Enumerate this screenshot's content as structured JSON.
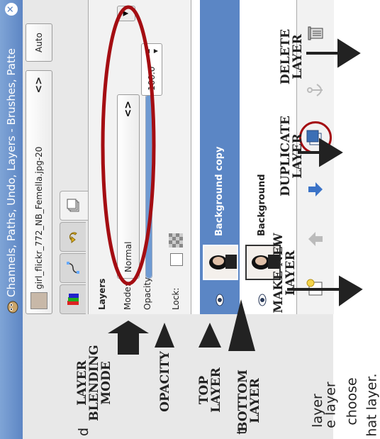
{
  "window": {
    "title": "Channels, Paths, Undo, Layers - Brushes, Patte",
    "close_icon": "close-icon",
    "app_icon": "gimp-icon"
  },
  "image_selector": {
    "filename": "girl_flickr_772_NB_Femella.jpg-20",
    "arrows": "<>",
    "auto_label": "Auto"
  },
  "tabs": [
    {
      "name": "tab-channels",
      "icon": "channels-icon"
    },
    {
      "name": "tab-paths",
      "icon": "paths-icon"
    },
    {
      "name": "tab-undo",
      "icon": "undo-icon"
    },
    {
      "name": "tab-layers",
      "icon": "layers-icon",
      "active": true
    }
  ],
  "layers_panel": {
    "heading": "Layers",
    "mode_label": "Mode:",
    "mode_value": "Normal",
    "mode_arrows": "<>",
    "opacity_label": "Opacity:",
    "opacity_value": "100.0",
    "opacity_percent": 100,
    "lock_label": "Lock:",
    "layers": [
      {
        "name": "Background copy",
        "selected": true,
        "visible": true
      },
      {
        "name": "Background",
        "selected": false,
        "visible": true
      }
    ]
  },
  "buttons": [
    {
      "name": "new-layer-button",
      "icon": "new-layer-icon"
    },
    {
      "name": "raise-layer-button",
      "icon": "arrow-up-icon"
    },
    {
      "name": "lower-layer-button",
      "icon": "arrow-down-icon"
    },
    {
      "name": "duplicate-layer-button",
      "icon": "duplicate-icon"
    },
    {
      "name": "anchor-layer-button",
      "icon": "anchor-icon"
    },
    {
      "name": "delete-layer-button",
      "icon": "trash-icon"
    }
  ],
  "annotations": {
    "blending_mode": "LAYER\nBLENDING\nMODE",
    "opacity": "OPACITY",
    "top_layer": "TOP\nLAYER",
    "bottom_layer": "BOTTOM\nLAYER",
    "make_new": "MAKE NEW\nLAYER",
    "duplicate": "DUPLICATE\nLAYER",
    "delete": "DELETE\nLAYER"
  },
  "colors": {
    "accent": "#5b86c5",
    "annotation_red": "#a40d12",
    "arrow": "#222222"
  },
  "body_text": {
    "line1": "layer",
    "line2": "e layer",
    "line3": "choose",
    "line4": "hat layer.",
    "frag1": "t",
    "frag2": "d"
  }
}
